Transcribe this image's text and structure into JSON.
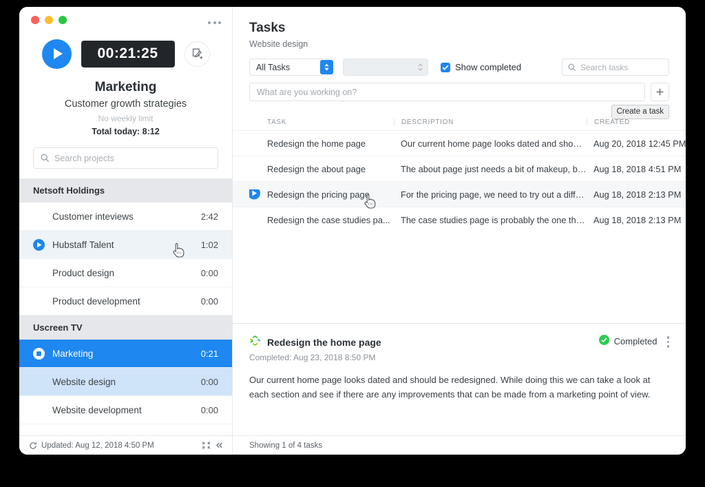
{
  "colors": {
    "accent": "#1e87f0",
    "timer_bg": "#22262b",
    "group_header_bg": "#e5e7ea",
    "active_row_bg": "#1e87f0",
    "child_row_bg": "#cfe3f9",
    "status_green": "#2ecc52",
    "traffic_red": "#ff5f57",
    "traffic_yellow": "#febc2e",
    "traffic_green": "#28c840"
  },
  "window": {
    "traffic_lights": [
      "close-button",
      "minimize-button",
      "maximize-button"
    ],
    "overflow_menu_icon": "ellipsis-icon"
  },
  "sidebar": {
    "timer": {
      "play_icon": "play-icon",
      "elapsed": "00:21:25",
      "note_icon": "add-note-icon"
    },
    "project_name": "Marketing",
    "project_task": "Customer growth strategies",
    "weekly_limit": "No weekly limit",
    "total_today": "Total today: 8:12",
    "search": {
      "icon": "search-icon",
      "placeholder": "Search projects",
      "value": ""
    },
    "groups": [
      {
        "name": "Netsoft Holdings",
        "items": [
          {
            "label": "Customer inteviews",
            "time": "2:42",
            "icon": "",
            "state": "default"
          },
          {
            "label": "Hubstaff Talent",
            "time": "1:02",
            "icon": "play-icon",
            "state": "hover"
          },
          {
            "label": "Product design",
            "time": "0:00",
            "icon": "",
            "state": "default"
          },
          {
            "label": "Product development",
            "time": "0:00",
            "icon": "",
            "state": "default"
          }
        ]
      },
      {
        "name": "Uscreen TV",
        "items": [
          {
            "label": "Marketing",
            "time": "0:21",
            "icon": "stop-icon",
            "state": "active"
          },
          {
            "label": "Website design",
            "time": "0:00",
            "icon": "",
            "state": "child"
          },
          {
            "label": "Website development",
            "time": "0:00",
            "icon": "",
            "state": "default"
          }
        ]
      }
    ],
    "footer": {
      "refresh_icon": "refresh-icon",
      "updated": "Updated: Aug 12, 2018 4:50 PM",
      "compact_icon": "compact-view-icon",
      "collapse_icon": "collapse-left-icon"
    }
  },
  "main": {
    "title": "Tasks",
    "subtitle": "Website design",
    "toolbar": {
      "filter_select": {
        "value": "All Tasks",
        "options": [
          "All Tasks"
        ]
      },
      "secondary_select": {
        "value": "",
        "options": []
      },
      "show_completed": {
        "label": "Show completed",
        "checked": true,
        "icon": "checkmark-icon"
      },
      "search": {
        "icon": "search-icon",
        "placeholder": "Search tasks",
        "value": ""
      }
    },
    "new_task": {
      "placeholder": "What are you working on?",
      "value": "",
      "add_icon": "plus-icon",
      "tooltip": "Create a task"
    },
    "table": {
      "columns": [
        "TASK",
        "DESCRIPTION",
        "CREATED"
      ],
      "rows": [
        {
          "task": "Redesign the home page",
          "description": "Our current home page looks dated and should...",
          "created": "Aug 20, 2018 12:45 PM",
          "icon": "",
          "state": "default"
        },
        {
          "task": "Redesign the about page",
          "description": "The about page just needs a bit of makeup, bec...",
          "created": "Aug 18, 2018 4:51 PM",
          "icon": "",
          "state": "default"
        },
        {
          "task": "Redesign the pricing page",
          "description": "For the pricing page, we need to try out a differe...",
          "created": "Aug 18, 2018 2:13 PM",
          "icon": "play-icon",
          "state": "hover"
        },
        {
          "task": "Redesign the case studies pa...",
          "description": "The case studies page is probably the one that ...",
          "created": "Aug 18, 2018 2:13 PM",
          "icon": "",
          "state": "default"
        }
      ]
    },
    "detail": {
      "integration_icon": "hubstaff-logo-icon",
      "title": "Redesign the home page",
      "meta": "Completed: Aug 23, 2018 8:50 PM",
      "status_label": "Completed",
      "status_icon": "check-circle-icon",
      "menu_icon": "vertical-ellipsis-icon",
      "body": "Our current home page looks dated and should be redesigned. While doing this we can take a look at each section and see if there are any improvements that can be made from a marketing point of view."
    },
    "footer": {
      "showing": "Showing 1 of 4 tasks"
    }
  }
}
